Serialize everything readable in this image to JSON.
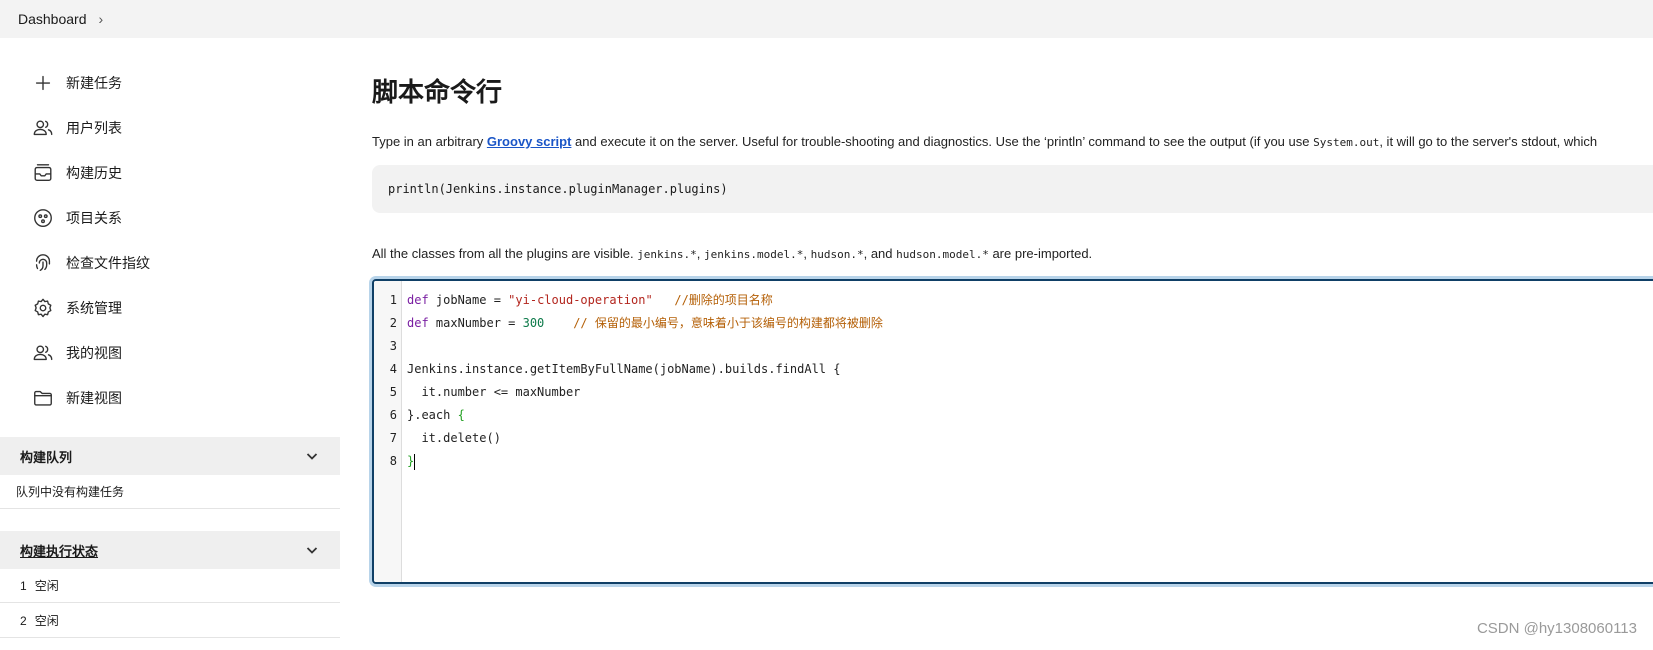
{
  "breadcrumb": {
    "item": "Dashboard",
    "chevron": "›"
  },
  "sidebar": {
    "items": [
      {
        "label": "新建任务",
        "icon": "plus-icon"
      },
      {
        "label": "用户列表",
        "icon": "users-icon"
      },
      {
        "label": "构建历史",
        "icon": "history-icon"
      },
      {
        "label": "项目关系",
        "icon": "relationship-icon"
      },
      {
        "label": "检查文件指纹",
        "icon": "fingerprint-icon"
      },
      {
        "label": "系统管理",
        "icon": "gear-icon"
      },
      {
        "label": "我的视图",
        "icon": "users-icon"
      },
      {
        "label": "新建视图",
        "icon": "folder-icon"
      }
    ],
    "queue": {
      "title": "构建队列",
      "empty": "队列中没有构建任务"
    },
    "executors": {
      "title": "构建执行状态",
      "rows": [
        {
          "num": "1",
          "status": "空闲"
        },
        {
          "num": "2",
          "status": "空闲"
        }
      ]
    }
  },
  "main": {
    "title": "脚本命令行",
    "desc_before": "Type in an arbitrary ",
    "desc_link": "Groovy script",
    "desc_mid": " and execute it on the server. Useful for trouble-shooting and diagnostics. Use the ‘println’ command to see the output (if you use ",
    "desc_code": "System.out",
    "desc_after": ", it will go to the server's stdout, which",
    "example": "println(Jenkins.instance.pluginManager.plugins)",
    "imports_before": "All the classes from all the plugins are visible. ",
    "import1": "jenkins.*",
    "sep1": ", ",
    "import2": "jenkins.model.*",
    "sep2": ", ",
    "import3": "hudson.*",
    "sep3": ", and ",
    "import4": "hudson.model.*",
    "imports_after": " are pre-imported."
  },
  "editor": {
    "line_numbers": [
      "1",
      "2",
      "3",
      "4",
      "5",
      "6",
      "7",
      "8"
    ],
    "l1": {
      "kw": "def",
      "rest": " jobName = ",
      "str": "\"yi-cloud-operation\"",
      "comment": "   //删除的项目名称"
    },
    "l2": {
      "kw": "def",
      "rest": " maxNumber = ",
      "num": "300",
      "comment": "    // 保留的最小编号，意味着小于该编号的构建都将被删除"
    },
    "l4": "Jenkins.instance.getItemByFullName(jobName).builds.findAll {",
    "l5": "  it.number <= maxNumber",
    "l6": {
      "text": "}.each ",
      "brace": "{"
    },
    "l7": "  it.delete()",
    "l8": "}"
  },
  "watermark": "CSDN @hy1308060113"
}
